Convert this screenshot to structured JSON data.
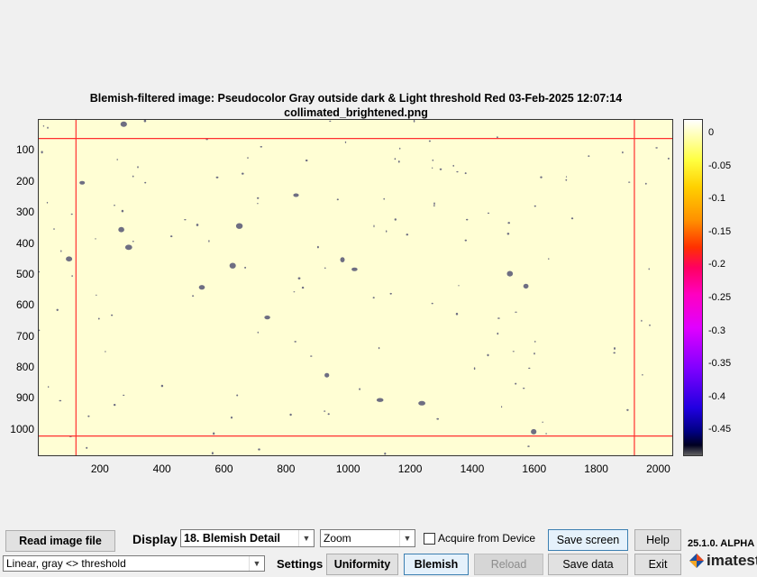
{
  "figure": {
    "title_line1": "Blemish-filtered image:  Pseudocolor  Gray outside dark & Light threshold    Red   03-Feb-2025 12:07:14",
    "title_line2": "collimated_brightened.png",
    "y_ticks": [
      "100",
      "200",
      "300",
      "400",
      "500",
      "600",
      "700",
      "800",
      "900",
      "1000"
    ],
    "x_ticks": [
      "200",
      "400",
      "600",
      "800",
      "1000",
      "1200",
      "1400",
      "1600",
      "1800",
      "2000"
    ],
    "colorbar_ticks": [
      "0",
      "-0.05",
      "-0.1",
      "-0.15",
      "-0.2",
      "-0.25",
      "-0.3",
      "-0.35",
      "-0.4",
      "-0.45"
    ],
    "colorbar_colors": [
      "#ffffff",
      "#ffff40",
      "#ff9000",
      "#ff0060",
      "#e000ff",
      "#8000ff",
      "#000080"
    ],
    "image_background": "#fffed4",
    "roi_line_color": "#ff3030",
    "blemish_color": "#6e6e82",
    "roi_bounds": {
      "x_left": 120,
      "x_right": 1920,
      "y_top": 60,
      "y_bottom": 1020
    },
    "image_extent": {
      "x_max": 2048,
      "y_max": 1088
    }
  },
  "toolbar": {
    "read_image_label": "Read image file",
    "display_label": "Display",
    "display_value": "18. Blemish Detail",
    "zoom_value": "Zoom",
    "acquire_label": "Acquire from Device",
    "save_screen_label": "Save screen",
    "help_label": "Help",
    "version": "25.1.0. ALPHA",
    "scale_value": "Linear, gray <> threshold",
    "settings_label": "Settings",
    "uniformity_label": "Uniformity",
    "blemish_label": "Blemish",
    "reload_label": "Reload",
    "save_data_label": "Save data",
    "exit_label": "Exit",
    "brand": "imatest"
  }
}
